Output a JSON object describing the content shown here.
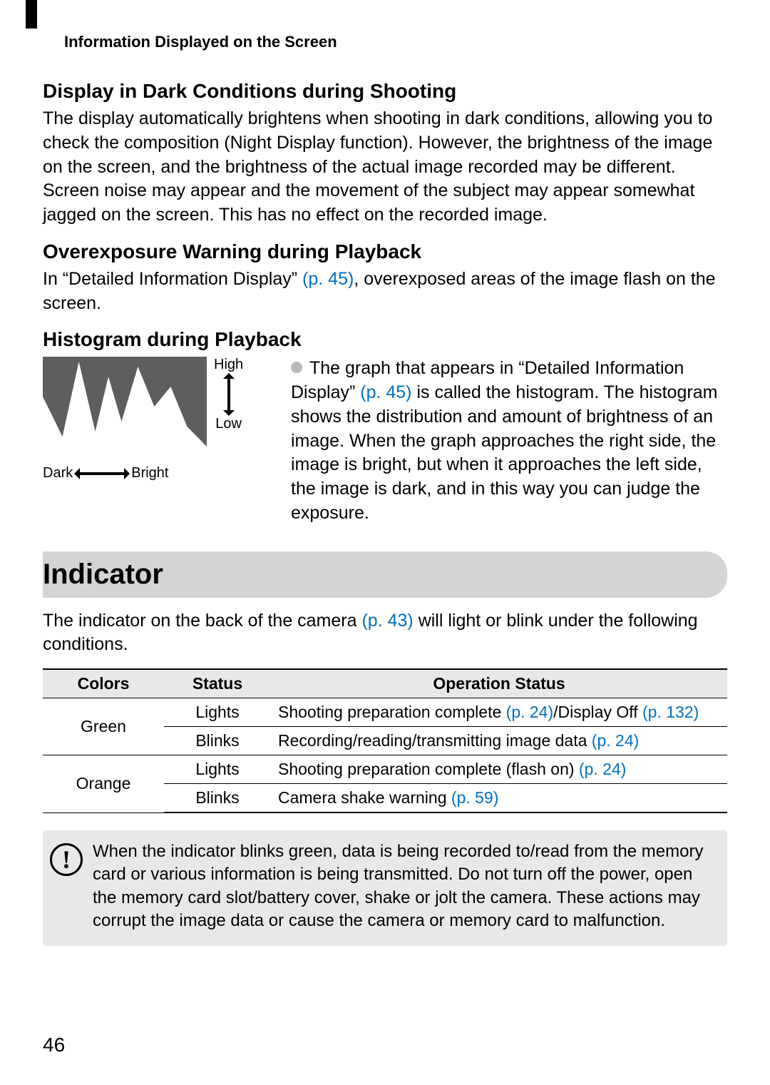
{
  "running_head": "Information Displayed on the Screen",
  "section1": {
    "title": "Display in Dark Conditions during Shooting",
    "body": "The display automatically brightens when shooting in dark conditions, allowing you to check the composition (Night Display function). However, the brightness of the image on the screen, and the brightness of the actual image recorded may be different. Screen noise may appear and the movement of the subject may appear somewhat jagged on the screen. This has no effect on the recorded image."
  },
  "section2": {
    "title": "Overexposure Warning during Playback",
    "body_pre": "In “Detailed Information Display” ",
    "pref": "(p. 45)",
    "body_post": ", overexposed areas of the image flash on the screen."
  },
  "section3": {
    "title": "Histogram during Playback",
    "labels": {
      "high": "High",
      "low": "Low",
      "dark": "Dark",
      "bright": "Bright"
    },
    "body_pre": "The graph that appears in “Detailed Information Display” ",
    "pref": "(p. 45)",
    "body_post": " is called the histogram. The histogram shows the distribution and amount of brightness of an image. When the graph approaches the right side, the image is bright, but when it approaches the left side, the image is dark, and in this way you can judge the exposure."
  },
  "indicator": {
    "title": "Indicator",
    "intro_pre": "The indicator on the back of the camera ",
    "intro_ref": "(p. 43)",
    "intro_post": " will light or blink under the following conditions.",
    "headers": {
      "colors": "Colors",
      "status": "Status",
      "op": "Operation Status"
    },
    "rows": [
      {
        "color": "Green",
        "status": "Lights",
        "op_pre": "Shooting preparation complete ",
        "ref1": "(p. 24)",
        "op_mid": "/Display Off ",
        "ref2": "(p. 132)",
        "op_post": ""
      },
      {
        "color": "",
        "status": "Blinks",
        "op_pre": "Recording/reading/transmitting image data ",
        "ref1": "(p. 24)",
        "op_mid": "",
        "ref2": "",
        "op_post": ""
      },
      {
        "color": "Orange",
        "status": "Lights",
        "op_pre": "Shooting preparation complete (flash on) ",
        "ref1": "(p. 24)",
        "op_mid": "",
        "ref2": "",
        "op_post": ""
      },
      {
        "color": "",
        "status": "Blinks",
        "op_pre": "Camera shake warning ",
        "ref1": "(p. 59)",
        "op_mid": "",
        "ref2": "",
        "op_post": ""
      }
    ],
    "warning": "When the indicator blinks green, data is being recorded to/read from the memory card or various information is being transmitted. Do not turn off the power, open the memory card slot/battery cover, shake or jolt the camera. These actions may corrupt the image data or cause the camera or memory card to malfunction."
  },
  "page_number": "46",
  "chart_data": {
    "type": "area",
    "description": "Illustrative brightness histogram",
    "xlabel": "Brightness (Dark → Bright)",
    "ylabel": "Pixel count (Low → High)",
    "x": [
      0,
      12,
      22,
      32,
      40,
      48,
      58,
      68,
      78,
      88,
      100
    ],
    "y": [
      60,
      20,
      95,
      25,
      80,
      35,
      90,
      50,
      70,
      30,
      10
    ],
    "ylim": [
      0,
      100
    ]
  }
}
